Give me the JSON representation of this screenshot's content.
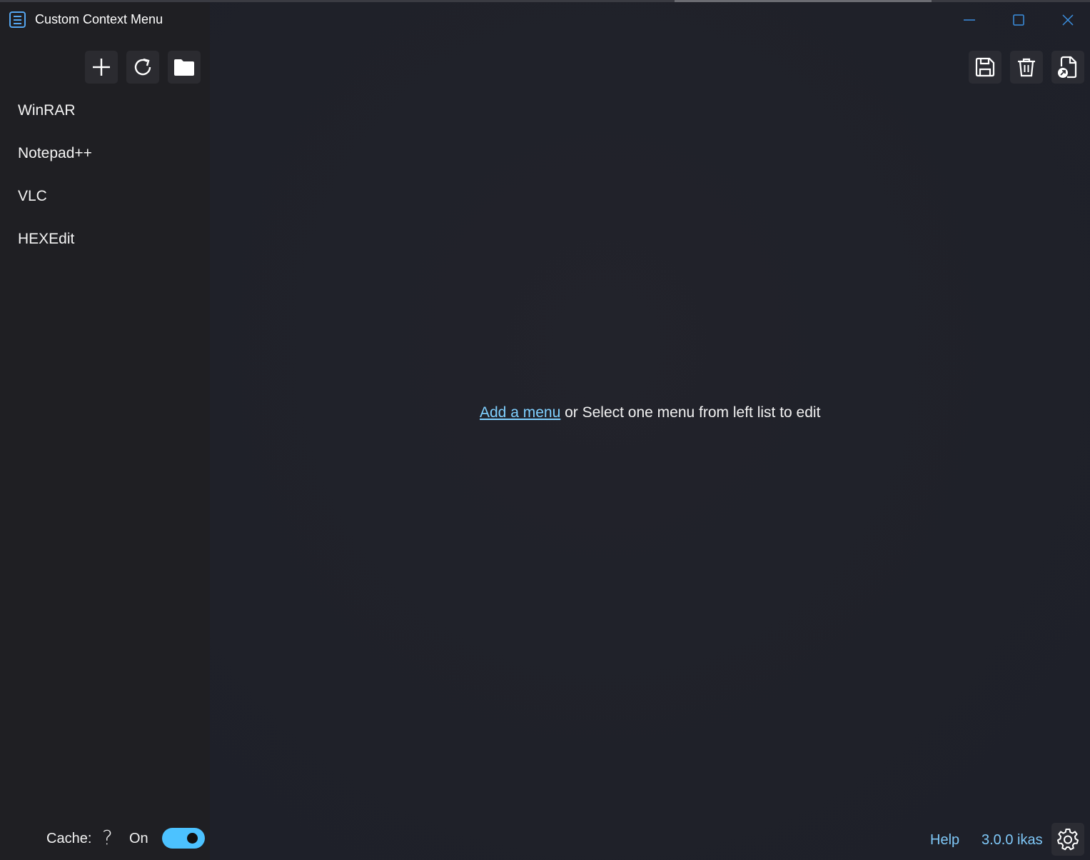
{
  "window": {
    "title": "Custom Context Menu",
    "controls": [
      "minimize-icon",
      "maximize-icon",
      "close-icon"
    ]
  },
  "sidebar": {
    "toolbar": [
      {
        "icon": "plus-icon",
        "name": "add-menu-button"
      },
      {
        "icon": "refresh-icon",
        "name": "refresh-button"
      },
      {
        "icon": "folder-icon",
        "name": "open-folder-button"
      }
    ],
    "items": [
      {
        "label": "WinRAR"
      },
      {
        "label": "Notepad++"
      },
      {
        "label": "VLC"
      },
      {
        "label": "HEXEdit"
      }
    ],
    "cache": {
      "label": "Cache:",
      "help": "?",
      "state": "On",
      "enabled": true
    }
  },
  "main": {
    "toolbar": [
      {
        "icon": "save-icon",
        "name": "save-button"
      },
      {
        "icon": "trash-icon",
        "name": "delete-button"
      },
      {
        "icon": "export-file-icon",
        "name": "export-button"
      }
    ],
    "empty_state": {
      "link": "Add a menu",
      "text": " or Select one menu from left list to edit"
    },
    "footer": {
      "help": "Help",
      "version": "3.0.0 ikas"
    }
  },
  "colors": {
    "accent": "#4cc2ff",
    "link": "#7fd0ff",
    "window_controls": "#3b8fe0",
    "sidebar_bg": "#1f1f23",
    "main_bg": "#202129"
  }
}
